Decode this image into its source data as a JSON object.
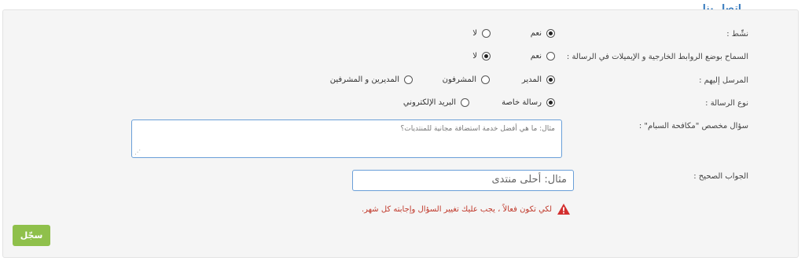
{
  "title": "اتصل بنا",
  "fields": {
    "active": {
      "label": "نشّط :",
      "opt_yes": "نعم",
      "opt_no": "لا"
    },
    "links": {
      "label": "السماح بوضع الروابط الخارجية و الإيميلات في الرسالة :",
      "opt_yes": "نعم",
      "opt_no": "لا"
    },
    "recipients": {
      "label": "المرسل إليهم :",
      "opt_admin": "المدير",
      "opt_moderators": "المشرفون",
      "opt_both": "المديرين و المشرفين"
    },
    "message_type": {
      "label": "نوع الرسالة :",
      "opt_private": "رسالة خاصة",
      "opt_email": "البريد الإلكتروني"
    },
    "antispam_question": {
      "label": "سؤال مخصص \"مكافحة السبام\" :",
      "placeholder": "مثال: ما هي أفضل خدمة استضافة مجانية للمنتديات؟"
    },
    "correct_answer": {
      "label": "الجواب الصحيح :",
      "placeholder": "مثال: أحلى منتدى"
    }
  },
  "warning": "لكي تكون فعالاً ، يجب عليك تغيير السؤال وإجابته كل شهر.",
  "submit_label": "سجّل",
  "colors": {
    "title": "#3d7fc0",
    "warning": "#c0392b",
    "button": "#8fc04b",
    "input_border": "#6a9fd8"
  }
}
